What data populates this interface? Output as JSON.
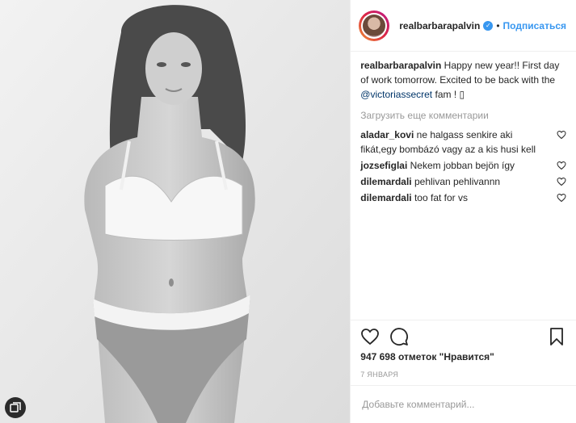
{
  "post": {
    "author": "realbarbarapalvin",
    "follow_label": "Подписаться",
    "dot": "•",
    "verified_mark": "✓",
    "caption": {
      "username": "realbarbarapalvin",
      "text_before": "Happy new year!! First day of work tomorrow. Excited to be back with the",
      "mention": "@victoriassecret",
      "text_after": "fam ! ▯"
    },
    "load_more_label": "Загрузить еще комментарии",
    "comments": [
      {
        "username": "aladar_kovi",
        "text": "ne halgass senkire aki fikát,egy bombázó vagy az a kis husi kell"
      },
      {
        "username": "jozsefiglai",
        "text": "Nekem jobban bejön így"
      },
      {
        "username": "dilemardali",
        "text": "pehlivan pehlivannn"
      },
      {
        "username": "dilemardali",
        "text": "too fat for vs"
      }
    ],
    "likes": "947 698 отметок \"Нравится\"",
    "date": "7 января",
    "comment_placeholder": "Добавьте комментарий...",
    "icons": {
      "like": "heart-icon",
      "comment": "comment-bubble-icon",
      "save": "bookmark-icon",
      "comment_like": "heart-icon",
      "carousel": "carousel-icon"
    },
    "colors": {
      "accent": "#3897f0",
      "mention": "#003569",
      "muted": "#999999",
      "text": "#262626"
    }
  }
}
